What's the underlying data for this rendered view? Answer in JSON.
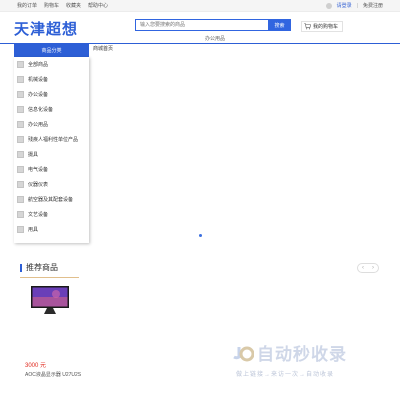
{
  "topbar": {
    "left_links": [
      "我的订单",
      "购物车",
      "收藏夹",
      "帮助中心"
    ],
    "login": "请登录",
    "register": "免费注册"
  },
  "brand": {
    "logo_text": "天津超想"
  },
  "search": {
    "placeholder": "输入您要搜索的商品",
    "button": "搜索",
    "hot_word": "办公用品"
  },
  "cart": {
    "label": "我的购物车"
  },
  "nav": {
    "category_title": "商品分类",
    "home_link": "商城首页"
  },
  "categories": [
    "全部商品",
    "机械设备",
    "办公设备",
    "信息化设备",
    "办公用品",
    "残疾人福利性单位产品",
    "摄具",
    "电气设备",
    "仪器仪表",
    "航空器及其配套设备",
    "文艺设备",
    "用具"
  ],
  "recommend": {
    "title": "推荐商品",
    "prev": "‹",
    "next": "›",
    "product": {
      "price": "3000 元",
      "name": "AOC液晶显示器 U27U2S"
    }
  },
  "watermark": {
    "main": "自动秒收录",
    "sub": "做上链接→来访一次→自动收录"
  },
  "colors": {
    "brand": "#2d5fd6",
    "price": "#e0281c"
  }
}
